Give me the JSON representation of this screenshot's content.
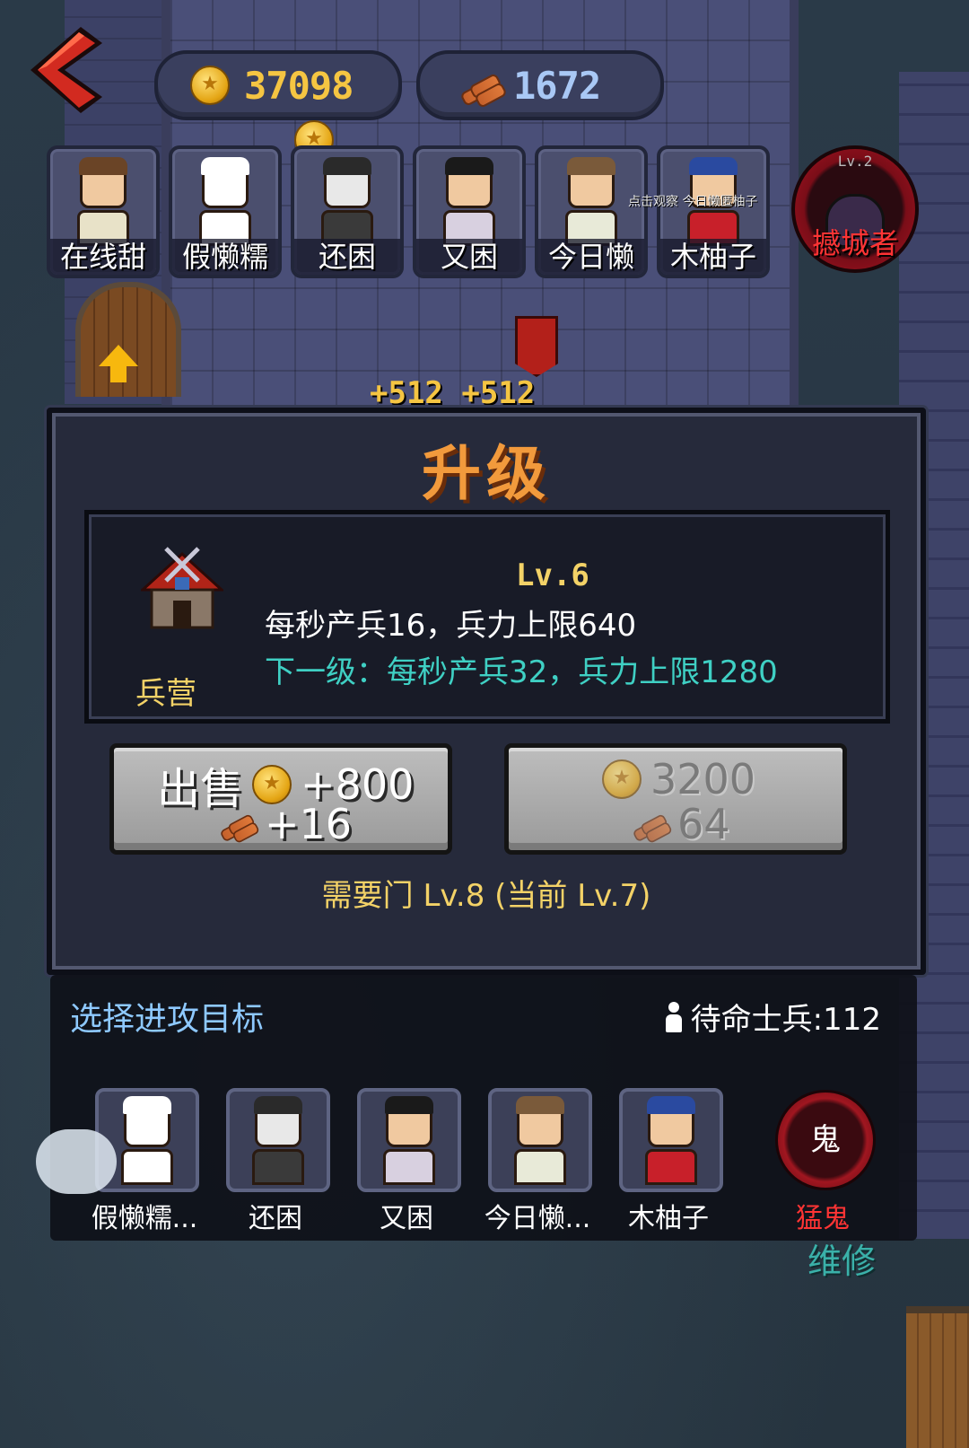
{
  "resources": {
    "gold": "37098",
    "wood": "1672"
  },
  "roster": [
    {
      "name": "在线甜",
      "hair": "#6a4426",
      "shirt": "#e8e2c8"
    },
    {
      "name": "假懒糯",
      "hair": "#ffffff",
      "shirt": "#ffffff"
    },
    {
      "name": "还困",
      "hair": "#2a2a2a",
      "shirt": "#3a3a3a"
    },
    {
      "name": "又困",
      "hair": "#1a1a1a",
      "shirt": "#d8d0e0"
    },
    {
      "name": "今日懒",
      "hair": "#7a5a3a",
      "shirt": "#e8ead8"
    },
    {
      "name": "木柚子",
      "hair": "#2a4aa0",
      "shirt": "#c8202a"
    }
  ],
  "enemy": {
    "level": "Lv.2",
    "name": "撼城者"
  },
  "watch_tip": "点击观察 今日懒匿柚子",
  "income_float": "+512 +512",
  "dialog": {
    "title": "升级",
    "building_name": "兵营",
    "level": "Lv.6",
    "current_stats": "每秒产兵16，兵力上限640",
    "next_stats": "下一级：每秒产兵32，兵力上限1280",
    "sell": {
      "label": "出售",
      "gold": "+800",
      "wood": "+16"
    },
    "upgrade": {
      "gold": "3200",
      "wood": "64"
    },
    "requirement": "需要门 Lv.8 (当前 Lv.7)"
  },
  "target_panel": {
    "title": "选择进攻目标",
    "troops_label": "待命士兵:112",
    "targets": [
      {
        "name": "假懒糯...",
        "hair": "#ffffff",
        "shirt": "#ffffff"
      },
      {
        "name": "还困",
        "hair": "#2a2a2a",
        "shirt": "#3a3a3a"
      },
      {
        "name": "又困",
        "hair": "#1a1a1a",
        "shirt": "#d8d0e0"
      },
      {
        "name": "今日懒...",
        "hair": "#7a5a3a",
        "shirt": "#e8ead8"
      },
      {
        "name": "木柚子",
        "hair": "#2a4aa0",
        "shirt": "#c8202a"
      }
    ],
    "ghost": {
      "glyph": "鬼",
      "name": "猛鬼"
    }
  },
  "repair_text": "维修",
  "colors": {
    "title_orange": "#f29a3c",
    "level_yellow": "#f3d267",
    "next_level_cyan": "#3fd0c4",
    "enemy_red": "#ff3434",
    "target_title_blue": "#8ec9ff"
  }
}
